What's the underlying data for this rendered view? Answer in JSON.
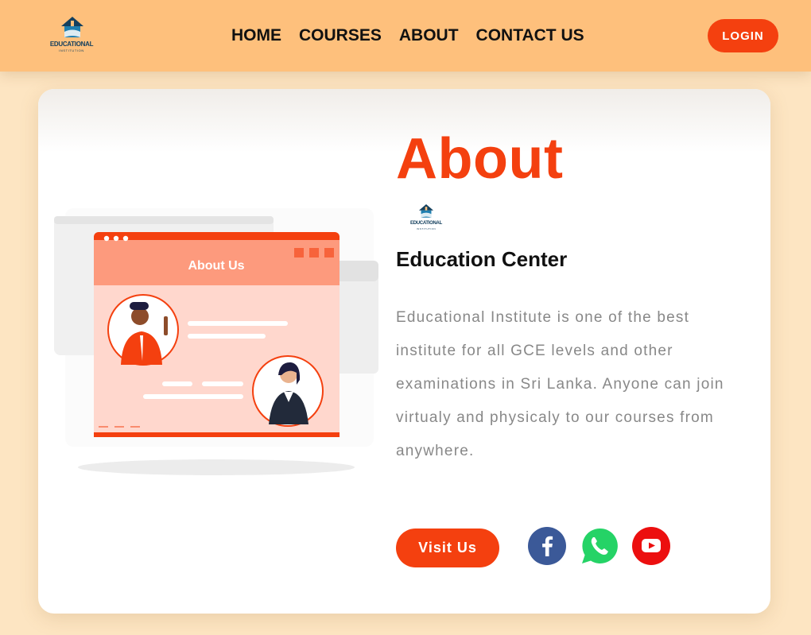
{
  "brand": {
    "name": "EDUCATIONAL",
    "tagline": "INSTITUTION"
  },
  "nav": {
    "links": [
      "HOME",
      "COURSES",
      "ABOUT",
      "CONTACT US"
    ],
    "login_label": "LOGIN"
  },
  "about": {
    "title": "About",
    "subtitle": "Education Center",
    "description": "Educational Institute is one of the best institute for all GCE levels and other examinations in Sri Lanka. Anyone can join virtualy and physicaly to our courses from anywhere.",
    "visit_label": "Visit Us"
  },
  "illustration": {
    "window_title": "About Us"
  },
  "social": {
    "icons": [
      "facebook-icon",
      "whatsapp-icon",
      "youtube-icon"
    ]
  },
  "colors": {
    "accent": "#f4400f",
    "navbar": "#fec07c",
    "page_background": "#fde5c2",
    "facebook": "#3b5998",
    "whatsapp": "#25d366",
    "youtube": "#ec0f0f",
    "brand_navy": "#14405e"
  }
}
